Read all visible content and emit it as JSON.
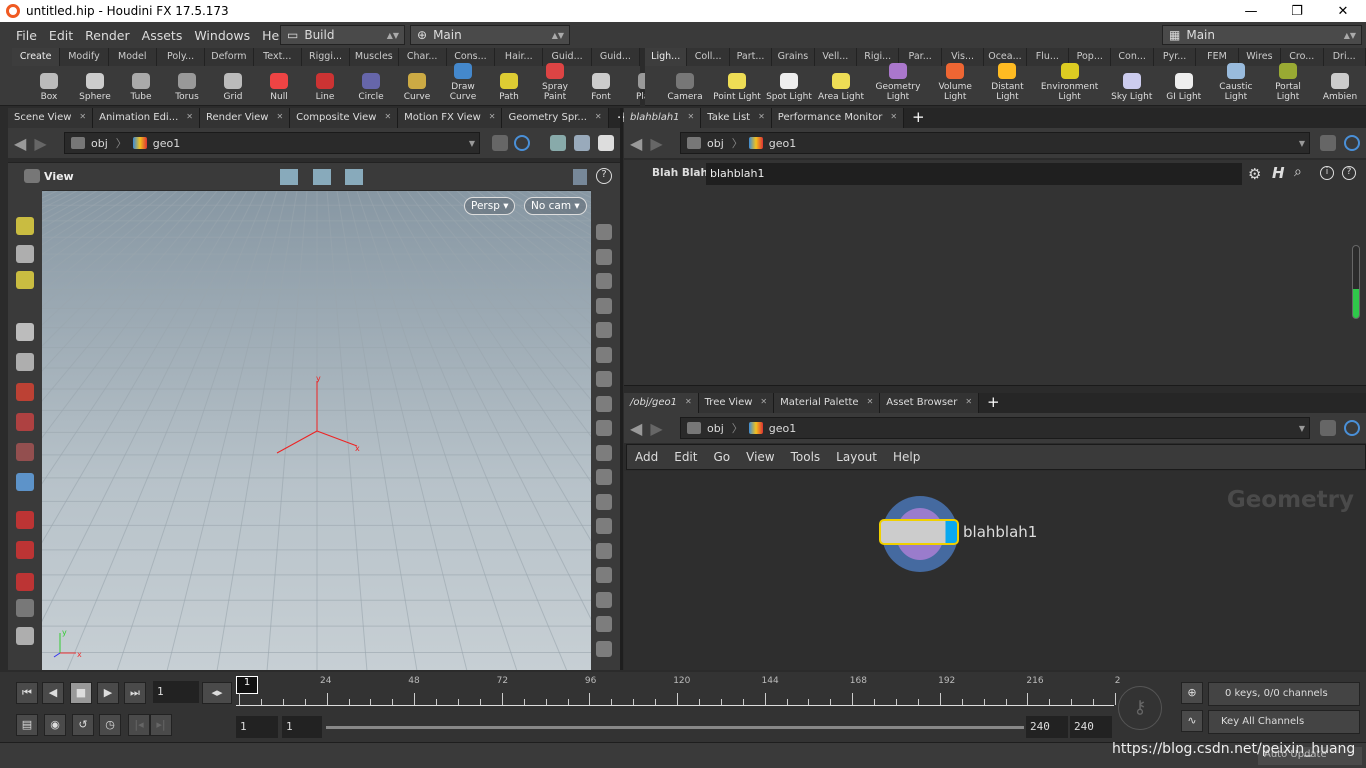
{
  "window": {
    "title": "untitled.hip - Houdini FX 17.5.173",
    "minimize": "—",
    "maximize": "❐",
    "close": "✕"
  },
  "menu": [
    "File",
    "Edit",
    "Render",
    "Assets",
    "Windows",
    "Help"
  ],
  "desktop": "Build",
  "context": "Main",
  "right_desktop": "Main",
  "shelf_left": {
    "tabs": [
      "Create",
      "Modify",
      "Model",
      "Poly...",
      "Deform",
      "Text...",
      "Riggi...",
      "Muscles",
      "Char...",
      "Cons...",
      "Hair...",
      "Guid...",
      "Guid..."
    ],
    "tools": [
      "Box",
      "Sphere",
      "Tube",
      "Torus",
      "Grid",
      "Null",
      "Line",
      "Circle",
      "Curve",
      "Draw Curve",
      "Path",
      "Spray Paint",
      "Font",
      "Pla S"
    ]
  },
  "shelf_right": {
    "tabs": [
      "Ligh...",
      "Coll...",
      "Part...",
      "Grains",
      "Vell...",
      "Rigi...",
      "Par...",
      "Vis...",
      "Ocea...",
      "Flu...",
      "Pop...",
      "Con...",
      "Pyr...",
      "FEM",
      "Wires",
      "Cro...",
      "Dri..."
    ],
    "tools": [
      "Camera",
      "Point Light",
      "Spot Light",
      "Area Light",
      "Geometry Light",
      "Volume Light",
      "Distant Light",
      "Environment Light",
      "Sky Light",
      "GI Light",
      "Caustic Light",
      "Portal Light",
      "Ambien"
    ]
  },
  "left_pane": {
    "tabs": [
      "Scene View",
      "Animation Edi...",
      "Render View",
      "Composite View",
      "Motion FX View",
      "Geometry Spr..."
    ],
    "path": [
      "obj",
      "geo1"
    ],
    "view_label": "View",
    "persp": "Persp ▾",
    "cam": "No cam ▾"
  },
  "param_pane": {
    "tabs": [
      "blahblah1",
      "Take List",
      "Performance Monitor"
    ],
    "path": [
      "obj",
      "geo1"
    ],
    "label": "Blah Blah",
    "value": "blahblah1"
  },
  "network_pane": {
    "tabs": [
      "/obj/geo1",
      "Tree View",
      "Material Palette",
      "Asset Browser"
    ],
    "path": [
      "obj",
      "geo1"
    ],
    "menu": [
      "Add",
      "Edit",
      "Go",
      "View",
      "Tools",
      "Layout",
      "Help"
    ],
    "context_label": "Geometry",
    "node_name": "blahblah1"
  },
  "timeline": {
    "current_frame": "1",
    "frame_marker": "1",
    "ticks": [
      "24",
      "48",
      "72",
      "96",
      "120",
      "144",
      "168",
      "192",
      "216",
      "2"
    ],
    "range_start": "1",
    "play_start": "1",
    "play_end": "240",
    "range_end": "240",
    "keys_info": "0 keys, 0/0 channels",
    "key_mode": "Key All Channels"
  },
  "status": {
    "update_mode": "Auto Update",
    "watermark": "https://blog.csdn.net/peixin_huang"
  }
}
